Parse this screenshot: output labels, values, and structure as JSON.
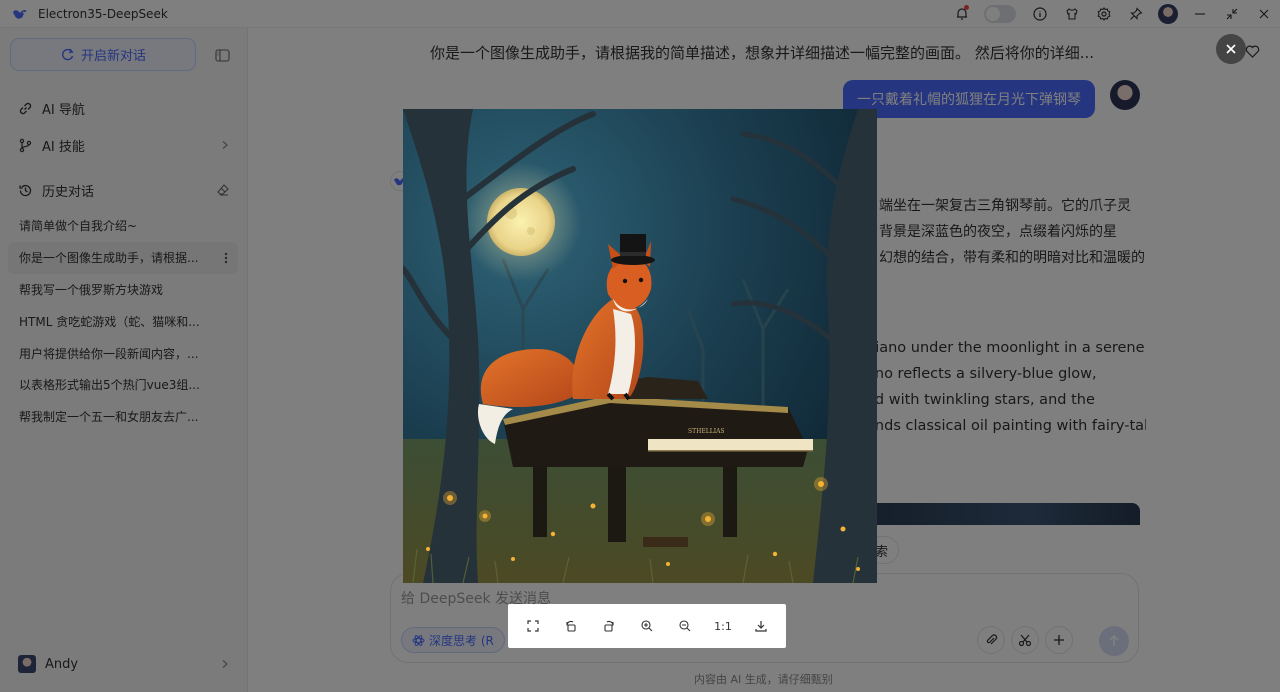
{
  "app": {
    "title": "Electron35-DeepSeek"
  },
  "titlebar": {
    "icons": [
      "bell-icon",
      "theme-toggle",
      "info-icon",
      "shirt-icon",
      "gear-icon",
      "pin-icon",
      "avatar",
      "minimize-icon",
      "restore-icon",
      "close-icon"
    ]
  },
  "sidebar": {
    "new_chat_label": "开启新对话",
    "nav": [
      {
        "label": "AI 导航",
        "icon": "link-icon"
      },
      {
        "label": "AI 技能",
        "icon": "branch-icon"
      }
    ],
    "history_label": "历史对话",
    "history": [
      "请简单做个自我介绍~",
      "你是一个图像生成助手，请根据...",
      "帮我写一个俄罗斯方块游戏",
      "HTML 贪吃蛇游戏（蛇、猫咪和...",
      "用户将提供给你一段新闻内容，...",
      "以表格形式输出5个热门vue3组...",
      "帮我制定一个五一和女朋友去广..."
    ],
    "user_name": "Andy"
  },
  "chat": {
    "title": "你是一个图像生成助手，请根据我的简单描述，想象并详细描述一幅完整的画面。 然后将你的详细...",
    "user_message": "一只戴着礼帽的狐狸在月光下弹钢琴",
    "answer_zh": [
      "端坐在一架复古三角钢琴前。它的爪子灵",
      "背景是深蓝色的夜空，点缀着闪烁的星",
      "幻想的结合，带有柔和的明暗对比和温暖的"
    ],
    "answer_en": [
      "piano under the moonlight in a serene",
      "ano reflects a silvery-blue glow,",
      "ed with twinkling stars, and the",
      "ends classical oil painting with fairy-tale"
    ],
    "search_chip": "索",
    "composer_placeholder": "给 DeepSeek 发送消息",
    "deep_think_label": "深度思考 (R",
    "footer_note": "内容由 AI 生成，请仔细甄别"
  },
  "preview": {
    "piano_brand": "STHELLIAS",
    "toolbar": [
      {
        "name": "fullscreen-icon",
        "label": ""
      },
      {
        "name": "rotate-left-icon",
        "label": ""
      },
      {
        "name": "rotate-right-icon",
        "label": ""
      },
      {
        "name": "zoom-in-icon",
        "label": ""
      },
      {
        "name": "zoom-out-icon",
        "label": ""
      },
      {
        "name": "actual-size-button",
        "label": "1:1"
      },
      {
        "name": "download-icon",
        "label": ""
      }
    ]
  },
  "colors": {
    "accent": "#4d6bfe",
    "overlay": "rgba(0,0,0,0.5)"
  }
}
